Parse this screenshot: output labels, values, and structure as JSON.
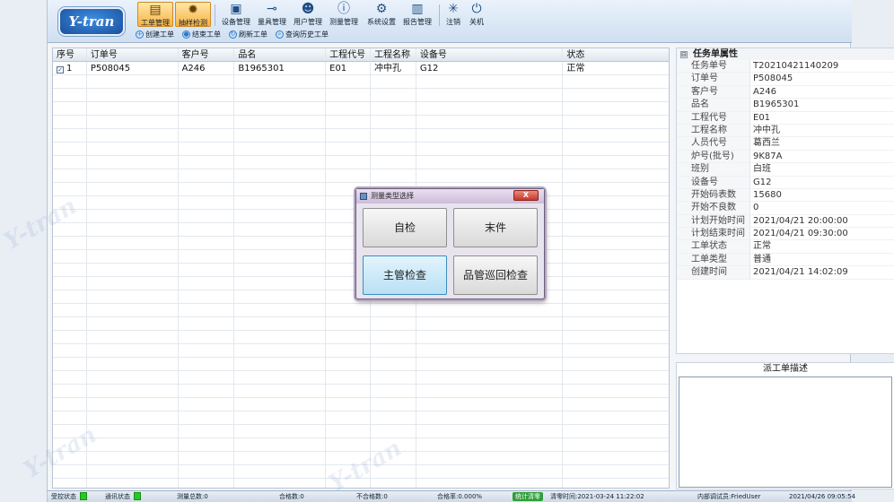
{
  "logo": {
    "text": "Y-tran"
  },
  "toolbar": {
    "buttons": [
      {
        "label": "工单管理",
        "icon": "clipboard-icon"
      },
      {
        "label": "抽样检测",
        "icon": "gear-icon"
      },
      {
        "label": "设备管理",
        "icon": "device-icon"
      },
      {
        "label": "量具管理",
        "icon": "gauge-icon"
      },
      {
        "label": "用户管理",
        "icon": "user-icon"
      },
      {
        "label": "测量管理",
        "icon": "measure-icon"
      },
      {
        "label": "系统设置",
        "icon": "settings-icon"
      },
      {
        "label": "报告管理",
        "icon": "report-icon"
      },
      {
        "label": "注销",
        "icon": "logout-icon"
      },
      {
        "label": "关机",
        "icon": "power-icon"
      }
    ],
    "sub_actions": [
      {
        "label": "创建工单",
        "icon": "plus-circle-icon"
      },
      {
        "label": "结束工单",
        "icon": "stop-circle-icon"
      },
      {
        "label": "刷新工单",
        "icon": "refresh-icon"
      },
      {
        "label": "查询历史工单",
        "icon": "search-icon"
      }
    ]
  },
  "table": {
    "headers": [
      "序号",
      "订单号",
      "客户号",
      "品名",
      "工程代号",
      "工程名称",
      "设备号",
      "状态"
    ],
    "rows": [
      [
        "1",
        "P508045",
        "A246",
        "B1965301",
        "E01",
        "冲中孔",
        "G12",
        "正常"
      ]
    ]
  },
  "properties": {
    "title": "任务单属性",
    "toggle": "⊟",
    "items": [
      {
        "key": "任务单号",
        "value": "T20210421140209"
      },
      {
        "key": "订单号",
        "value": "P508045"
      },
      {
        "key": "客户号",
        "value": "A246"
      },
      {
        "key": "品名",
        "value": "B1965301"
      },
      {
        "key": "工程代号",
        "value": "E01"
      },
      {
        "key": "工程名称",
        "value": "冲中孔"
      },
      {
        "key": "人员代号",
        "value": "葛西兰"
      },
      {
        "key": "炉号(批号)",
        "value": "9K87A"
      },
      {
        "key": "班别",
        "value": "白班"
      },
      {
        "key": "设备号",
        "value": "G12"
      },
      {
        "key": "开始码表数",
        "value": "15680"
      },
      {
        "key": "开始不良数",
        "value": "0"
      },
      {
        "key": "计划开始时间",
        "value": "2021/04/21 20:00:00"
      },
      {
        "key": "计划结束时间",
        "value": "2021/04/21 09:30:00"
      },
      {
        "key": "工单状态",
        "value": "正常"
      },
      {
        "key": "工单类型",
        "value": "普通"
      },
      {
        "key": "创建时间",
        "value": "2021/04/21 14:02:09"
      }
    ]
  },
  "description": {
    "title": "派工单描述",
    "text": ""
  },
  "dialog": {
    "title": "测量类型选择",
    "close": "X",
    "buttons": [
      "自检",
      "末件",
      "主管检查",
      "品管巡回检查"
    ]
  },
  "statusbar": {
    "control": "受控状态",
    "comm": "通讯状态",
    "total": "测量总数:0",
    "pass": "合格数:0",
    "fail": "不合格数:0",
    "rate": "合格率:0.000%",
    "clear_button": "统计清零",
    "clear_time": "清零时间:2021-03-24 11:22:02",
    "user": "内部调试员:FriedUser",
    "datetime": "2021/04/26 09:05:54"
  },
  "colors": {
    "accent": "#f6b244",
    "led": "#22cc22",
    "header_blue": "#1a4f9c"
  }
}
